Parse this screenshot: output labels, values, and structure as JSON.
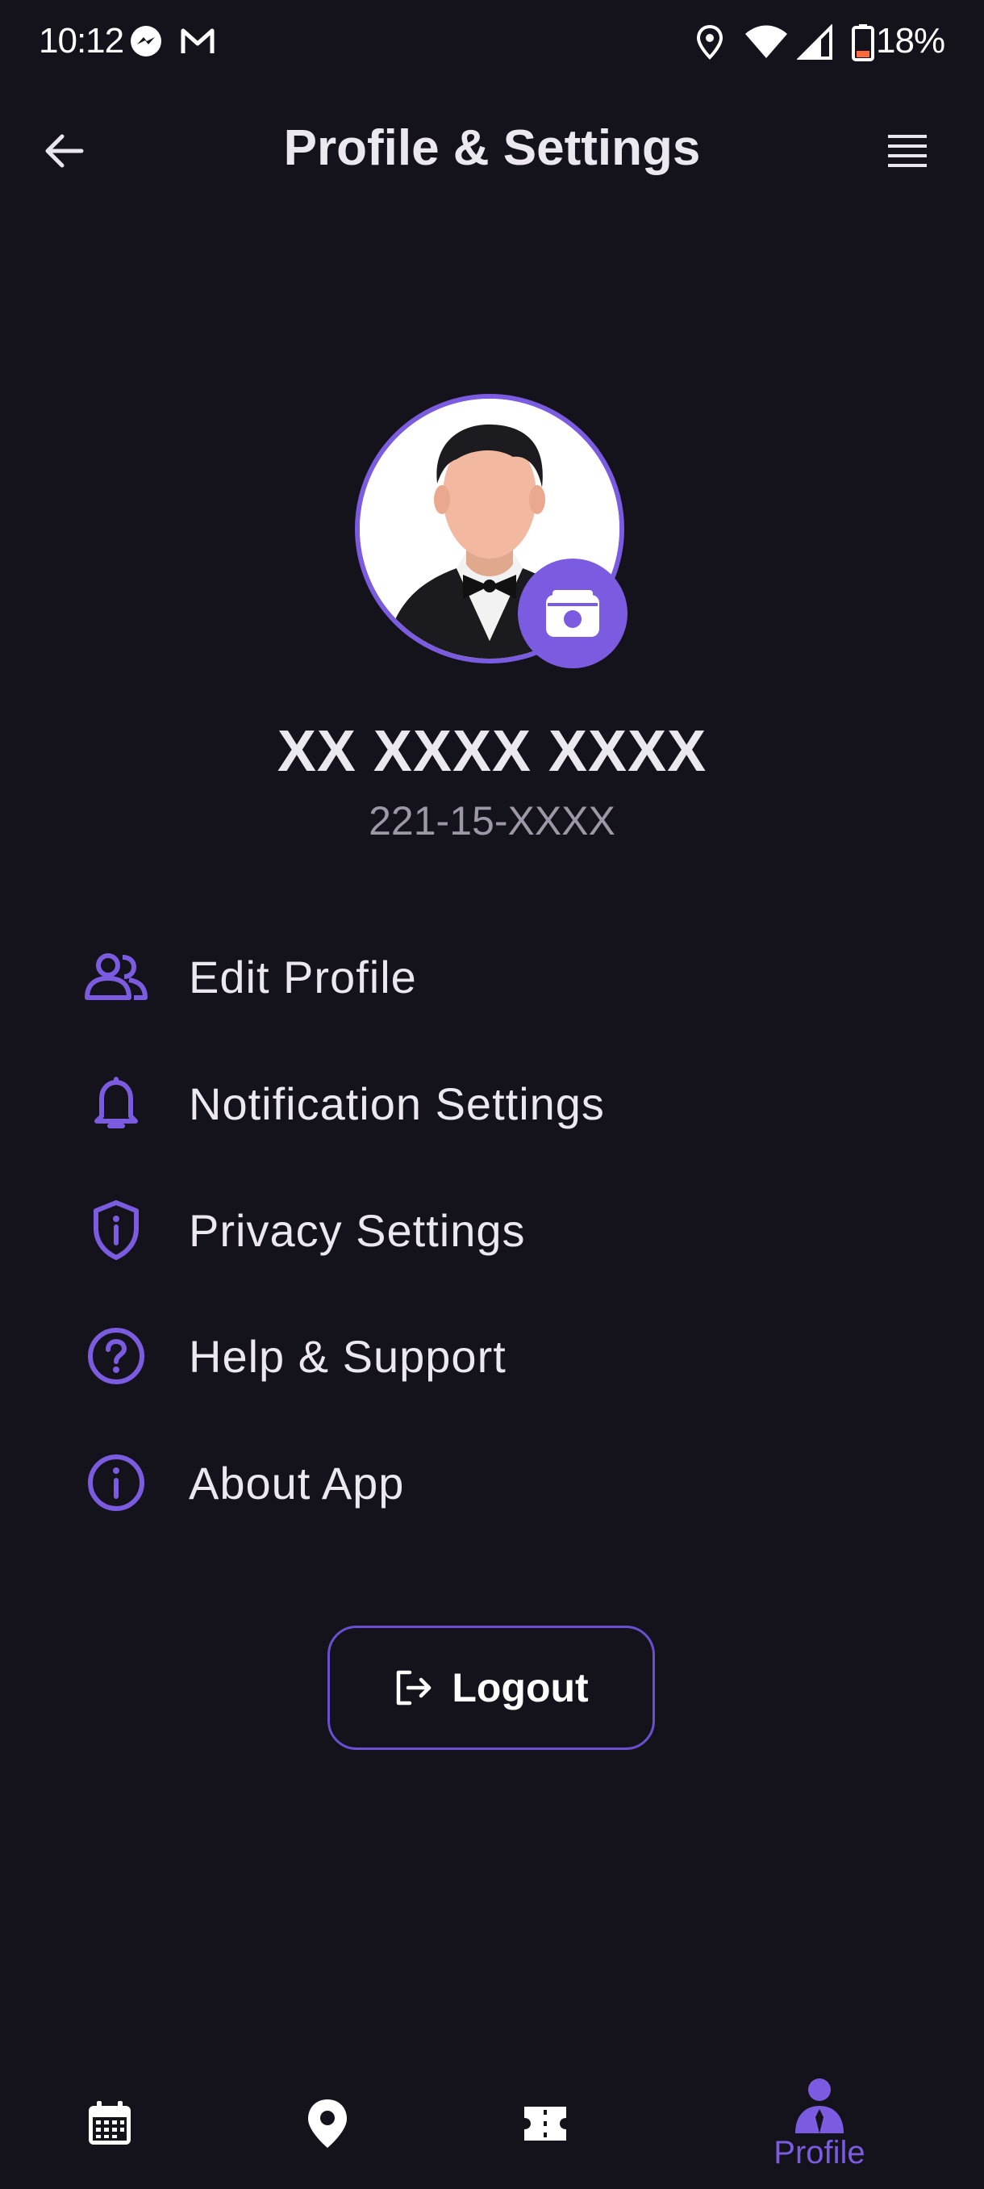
{
  "status_bar": {
    "time": "10:12",
    "battery": "18%",
    "icons": [
      "messenger-icon",
      "gmail-icon",
      "location-icon",
      "wifi-icon",
      "signal-icon",
      "battery-icon"
    ]
  },
  "header": {
    "title": "Profile & Settings",
    "back_icon": "arrow-left-icon",
    "menu_icon": "menu-icon"
  },
  "profile": {
    "name": "XX XXXX XXXX",
    "id": "221-15-XXXX",
    "camera_icon": "camera-icon"
  },
  "menu": {
    "items": [
      {
        "label": "Edit Profile",
        "icon": "users-icon"
      },
      {
        "label": "Notification Settings",
        "icon": "bell-icon"
      },
      {
        "label": "Privacy Settings",
        "icon": "shield-icon"
      },
      {
        "label": "Help & Support",
        "icon": "help-circle-icon"
      },
      {
        "label": "About App",
        "icon": "info-circle-icon"
      }
    ]
  },
  "logout": {
    "label": "Logout",
    "icon": "logout-icon"
  },
  "bottom_nav": {
    "items": [
      {
        "label": "",
        "icon": "calendar-icon"
      },
      {
        "label": "",
        "icon": "map-pin-icon"
      },
      {
        "label": "",
        "icon": "ticket-icon"
      },
      {
        "label": "Profile",
        "icon": "profile-icon",
        "active": true
      }
    ]
  },
  "colors": {
    "background": "#14121a",
    "accent": "#7b5be0",
    "text": "#ebe8f0",
    "muted": "#9c98a6"
  }
}
